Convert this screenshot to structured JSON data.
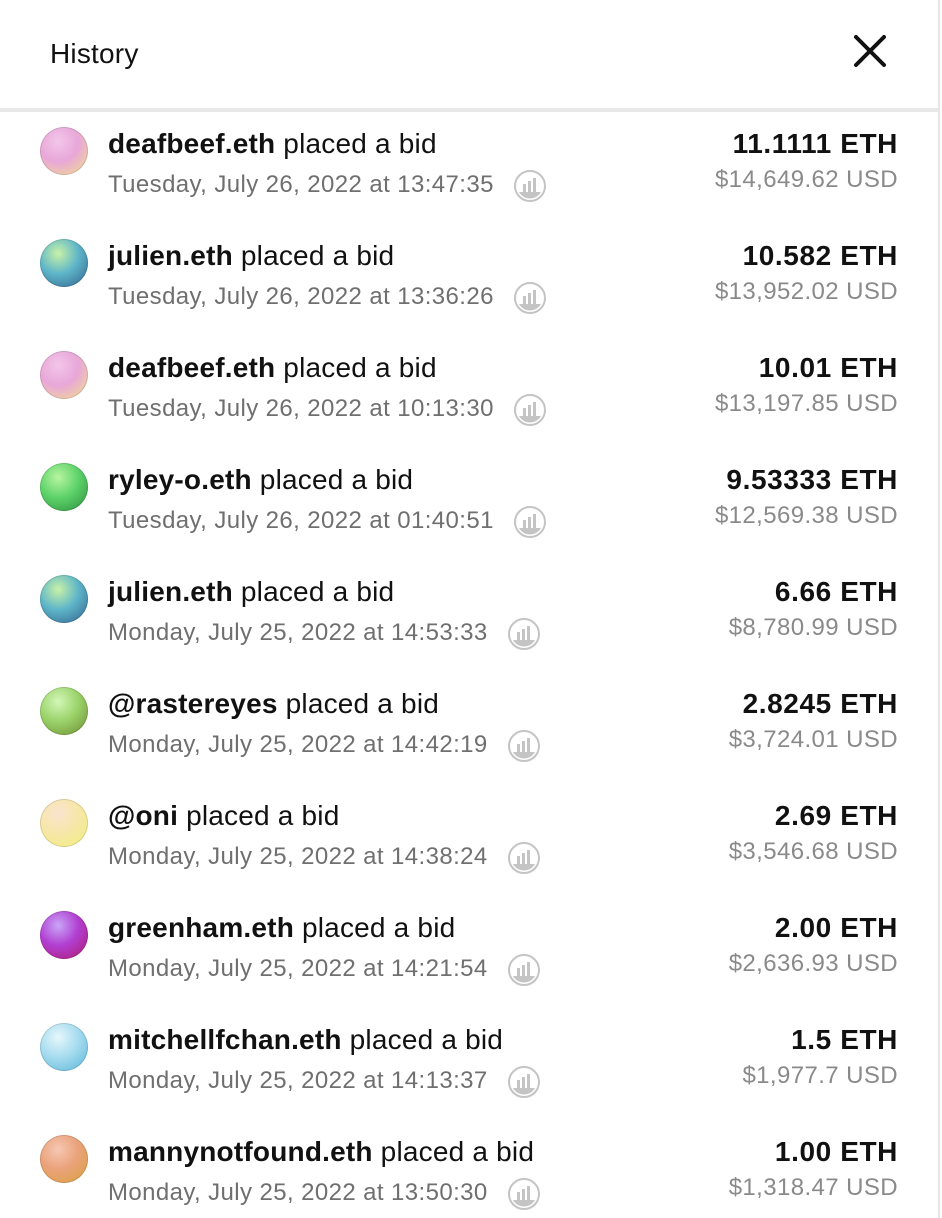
{
  "header": {
    "title": "History",
    "close_icon": "close-icon"
  },
  "bid_suffix": "placed a bid",
  "rows": [
    {
      "name": "deafbeef.eth",
      "action": " placed a bid",
      "time": "Tuesday, July 26, 2022 at 13:47:35",
      "eth": "11.1111 ETH",
      "usd": "$14,649.62 USD",
      "avatar": [
        "#f3c6ea",
        "#e8a7d8",
        "#f2e28a"
      ]
    },
    {
      "name": "julien.eth",
      "action": " placed a bid",
      "time": "Tuesday, July 26, 2022 at 13:36:26",
      "eth": "10.582 ETH",
      "usd": "$13,952.02 USD",
      "avatar": [
        "#c9f2a6",
        "#5fb6c9",
        "#2f5f8c"
      ]
    },
    {
      "name": "deafbeef.eth",
      "action": " placed a bid",
      "time": "Tuesday, July 26, 2022 at 10:13:30",
      "eth": "10.01 ETH",
      "usd": "$13,197.85 USD",
      "avatar": [
        "#f3c6ea",
        "#e8a7d8",
        "#f2e28a"
      ]
    },
    {
      "name": "ryley-o.eth",
      "action": " placed a bid",
      "time": "Tuesday, July 26, 2022 at 01:40:51",
      "eth": "9.53333 ETH",
      "usd": "$12,569.38 USD",
      "avatar": [
        "#b8f5a0",
        "#5ed36a",
        "#2a8c3c"
      ]
    },
    {
      "name": "julien.eth",
      "action": " placed a bid",
      "time": "Monday, July 25, 2022 at 14:53:33",
      "eth": "6.66 ETH",
      "usd": "$8,780.99 USD",
      "avatar": [
        "#c9f2a6",
        "#5fb6c9",
        "#2f5f8c"
      ]
    },
    {
      "name": "@rastereyes",
      "action": " placed a bid",
      "time": "Monday, July 25, 2022 at 14:42:19",
      "eth": "2.8245 ETH",
      "usd": "$3,724.01 USD",
      "avatar": [
        "#d2f7b8",
        "#9bd36a",
        "#6b8a2e"
      ]
    },
    {
      "name": "@oni",
      "action": " placed a bid",
      "time": "Monday, July 25, 2022 at 14:38:24",
      "eth": "2.69 ETH",
      "usd": "$3,546.68 USD",
      "avatar": [
        "#fbe3d0",
        "#f6e7a8",
        "#f2ef7c"
      ]
    },
    {
      "name": "greenham.eth",
      "action": " placed a bid",
      "time": "Monday, July 25, 2022 at 14:21:54",
      "eth": "2.00 ETH",
      "usd": "$2,636.93 USD",
      "avatar": [
        "#c9a6f7",
        "#b13fd1",
        "#b0186c"
      ]
    },
    {
      "name": "mitchellfchan.eth",
      "action": " placed a bid",
      "time": "Monday, July 25, 2022 at 14:13:37",
      "eth": "1.5 ETH",
      "usd": "$1,977.7 USD",
      "avatar": [
        "#e6f7fb",
        "#a6dcef",
        "#58b4d8"
      ]
    },
    {
      "name": "mannynotfound.eth",
      "action": " placed a bid",
      "time": "Monday, July 25, 2022 at 13:50:30",
      "eth": "1.00 ETH",
      "usd": "$1,318.47 USD",
      "avatar": [
        "#f6c7b4",
        "#eaa27a",
        "#d9a23a"
      ]
    }
  ],
  "row_icon": "etherscan-icon",
  "colors": {
    "text": "#111111",
    "muted": "#6f6f6f",
    "usd": "#8a8a8a",
    "divider": "#e8e8e8",
    "icon": "#bdbdbd"
  }
}
